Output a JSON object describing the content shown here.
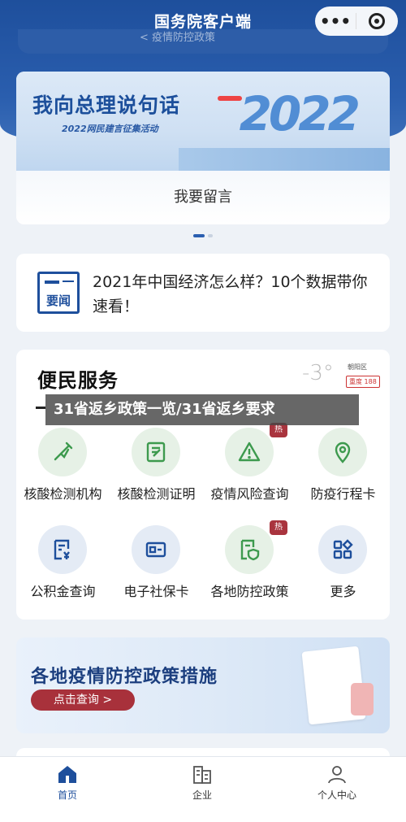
{
  "header": {
    "title": "国务院客户端",
    "capsule_more": "•••",
    "search_remnant": "< 疫情防控政策"
  },
  "banner": {
    "main_text": "我向总理说句话",
    "sub_text": "2022网民建言征集活动",
    "year_art": "2022",
    "caption": "我要留言",
    "pager": {
      "pages": 2,
      "active": 1
    }
  },
  "news": {
    "icon_label": "要闻",
    "text": "2021年中国经济怎么样？10个数据带你速看！"
  },
  "services": {
    "title": "便民服务",
    "weather": {
      "temperature": "-3°",
      "area": "朝阳区",
      "aqi": "重度 188"
    },
    "items": [
      {
        "label": "核酸检测机构",
        "icon": "test-tube-icon",
        "hot": false,
        "style": "green"
      },
      {
        "label": "核酸检测证明",
        "icon": "certificate-icon",
        "hot": false,
        "style": "green"
      },
      {
        "label": "疫情风险查询",
        "icon": "warning-icon",
        "hot": true,
        "style": "green"
      },
      {
        "label": "防疫行程卡",
        "icon": "location-pin-icon",
        "hot": false,
        "style": "green"
      },
      {
        "label": "公积金查询",
        "icon": "fund-document-icon",
        "hot": false,
        "style": "blue"
      },
      {
        "label": "电子社保卡",
        "icon": "social-security-card-icon",
        "hot": false,
        "style": "blue"
      },
      {
        "label": "各地防控政策",
        "icon": "shield-document-icon",
        "hot": true,
        "style": "green"
      },
      {
        "label": "更多",
        "icon": "grid-more-icon",
        "hot": false,
        "style": "blue"
      }
    ],
    "hot_label": "热"
  },
  "overlay": {
    "text": "31省返乡政策一览/31省返乡要求"
  },
  "promo": {
    "title": "各地疫情防控政策措施",
    "button": "点击查询 >"
  },
  "tabbar": {
    "tabs": [
      {
        "label": "首页",
        "icon": "home-icon",
        "active": true
      },
      {
        "label": "企业",
        "icon": "building-icon",
        "active": false
      },
      {
        "label": "个人中心",
        "icon": "person-icon",
        "active": false
      }
    ]
  },
  "colors": {
    "brand_blue": "#1e4f9c",
    "hot_red": "#a9343e",
    "service_green": "#3d9a4e"
  }
}
